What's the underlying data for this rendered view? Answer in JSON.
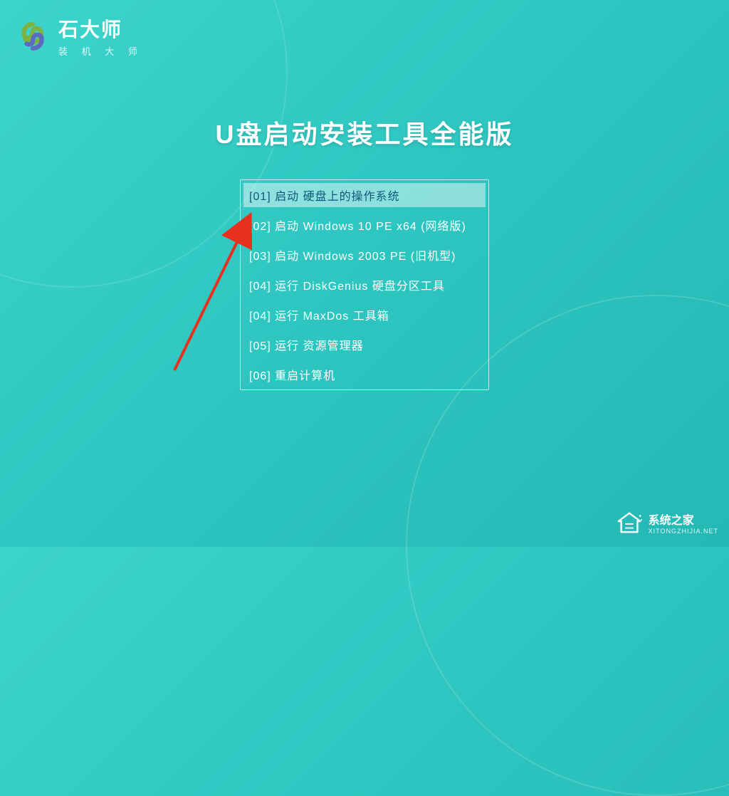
{
  "logo": {
    "title": "石大师",
    "subtitle": "装 机 大 师"
  },
  "page_title": "U盘启动安装工具全能版",
  "menu": {
    "items": [
      {
        "label": "[01] 启动 硬盘上的操作系统",
        "selected": true
      },
      {
        "label": "[02] 启动 Windows 10 PE x64 (网络版)",
        "selected": false
      },
      {
        "label": "[03] 启动 Windows 2003 PE (旧机型)",
        "selected": false
      },
      {
        "label": "[04] 运行 DiskGenius 硬盘分区工具",
        "selected": false
      },
      {
        "label": "[04] 运行 MaxDos 工具箱",
        "selected": false
      },
      {
        "label": "[05] 运行 资源管理器",
        "selected": false
      },
      {
        "label": "[06] 重启计算机",
        "selected": false
      }
    ]
  },
  "watermark": {
    "title": "系统之家",
    "url": "XITONGZHIJIA.NET"
  }
}
